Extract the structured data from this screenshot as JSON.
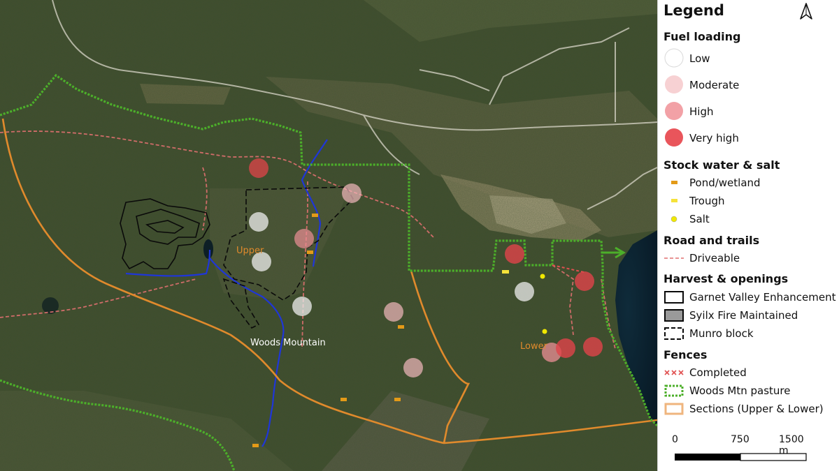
{
  "map": {
    "place_labels": {
      "upper": "Upper",
      "lower": "Lower",
      "woods_mountain": "Woods Mountain"
    },
    "colors": {
      "pasture_fence": "#4caf2a",
      "sections": "#e08a2c",
      "road": "#e07070",
      "creek": "#1f36d8",
      "harvest": "#0a0a0a",
      "fuel_low": "#eeeeee",
      "fuel_moderate": "#f2b8bc",
      "fuel_high": "#ec8f95",
      "fuel_very_high": "#e0444a",
      "pond": "#e39a18",
      "trough": "#f5e23a",
      "salt": "#f0e800"
    }
  },
  "legend": {
    "title": "Legend",
    "north_icon": "north-arrow-icon",
    "fuel": {
      "heading": "Fuel loading",
      "items": [
        {
          "label": "Low",
          "icon": "fuel-low-circle-icon",
          "color": "#ffffff"
        },
        {
          "label": "Moderate",
          "icon": "fuel-moderate-circle-icon",
          "color": "#f7d1d3"
        },
        {
          "label": "High",
          "icon": "fuel-high-circle-icon",
          "color": "#f2a1a6"
        },
        {
          "label": "Very high",
          "icon": "fuel-very-high-circle-icon",
          "color": "#e9555b"
        }
      ]
    },
    "stock": {
      "heading": "Stock water & salt",
      "items": [
        {
          "label": "Pond/wetland",
          "icon": "pond-icon"
        },
        {
          "label": "Trough",
          "icon": "trough-icon"
        },
        {
          "label": "Salt",
          "icon": "salt-dot-icon"
        }
      ]
    },
    "roads": {
      "heading": "Road and trails",
      "items": [
        {
          "label": "Driveable",
          "icon": "driveable-line-icon"
        }
      ]
    },
    "harvest": {
      "heading": "Harvest & openings",
      "items": [
        {
          "label": "Garnet Valley Enhancement",
          "icon": "solid-outline-box-icon"
        },
        {
          "label": "Syilx Fire Maintained",
          "icon": "grey-filled-box-icon"
        },
        {
          "label": "Munro block",
          "icon": "dashed-box-icon"
        }
      ]
    },
    "fences": {
      "heading": "Fences",
      "items": [
        {
          "label": "Completed",
          "icon": "completed-fence-icon"
        },
        {
          "label": "Woods Mtn pasture",
          "icon": "pasture-fence-icon"
        },
        {
          "label": "Sections (Upper & Lower)",
          "icon": "sections-box-icon"
        }
      ]
    },
    "scale": {
      "zero": "0",
      "mid": "750",
      "end": "1500 m"
    }
  }
}
